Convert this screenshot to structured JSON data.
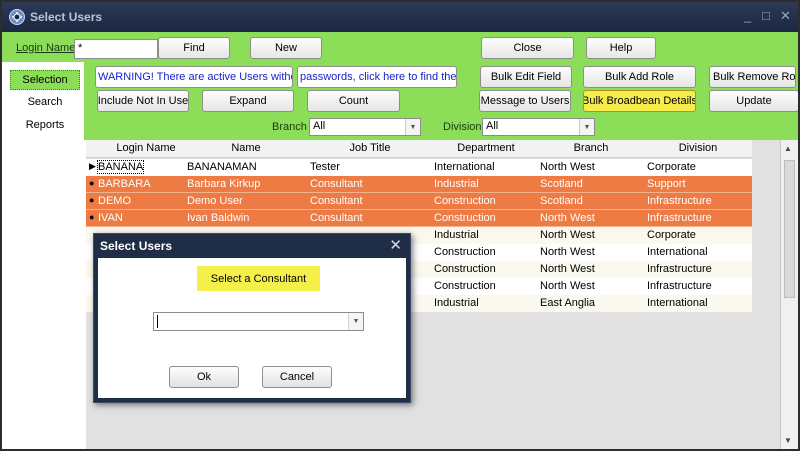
{
  "window": {
    "title": "Select Users",
    "controls": {
      "minimize": "_",
      "maximize": "□",
      "close": "✕"
    },
    "icon": "app-logo-icon"
  },
  "toolbar": {
    "login_label": "Login Name",
    "login_value": "*",
    "find": "Find",
    "new": "New",
    "close": "Close",
    "help": "Help",
    "warning_part1": "WARNING! There are active Users without",
    "warning_part2": "passwords, click here to find them.",
    "bulk_edit_field": "Bulk Edit Field",
    "bulk_add_role": "Bulk Add Role",
    "bulk_remove_role": "Bulk Remove Role",
    "include_not_in_use": "Include Not In Use",
    "expand": "Expand",
    "count": "Count",
    "message_to_users": "Message to Users",
    "bulk_broadbean_details": "Bulk Broadbean Details",
    "update": "Update",
    "branch_label": "Branch",
    "branch_value": "All",
    "division_label": "Division",
    "division_value": "All"
  },
  "sidebar": {
    "items": [
      {
        "label": "Selection"
      },
      {
        "label": "Search"
      },
      {
        "label": "Reports"
      }
    ]
  },
  "grid": {
    "columns": [
      "Login Name",
      "Name",
      "Job Title",
      "Department",
      "Branch",
      "Division"
    ],
    "rows": [
      {
        "indicator": "▶",
        "login": "BANANA",
        "name": "BANANAMAN",
        "job": "Tester",
        "dept": "International",
        "branch": "North West",
        "division": "Corporate"
      },
      {
        "indicator": "●",
        "login": "BARBARA",
        "name": "Barbara Kirkup",
        "job": "Consultant",
        "dept": "Industrial",
        "branch": "Scotland",
        "division": "Support"
      },
      {
        "indicator": "●",
        "login": "DEMO",
        "name": "Demo User",
        "job": "Consultant",
        "dept": "Construction",
        "branch": "Scotland",
        "division": "Infrastructure"
      },
      {
        "indicator": "●",
        "login": "IVAN",
        "name": "Ivan Baldwin",
        "job": "Consultant",
        "dept": "Construction",
        "branch": "North West",
        "division": "Infrastructure"
      },
      {
        "indicator": "",
        "login": "",
        "name": "",
        "job": "",
        "dept": "Industrial",
        "branch": "North West",
        "division": "Corporate"
      },
      {
        "indicator": "",
        "login": "",
        "name": "",
        "job": "",
        "dept": "Construction",
        "branch": "North West",
        "division": "International"
      },
      {
        "indicator": "",
        "login": "",
        "name": "",
        "job": "",
        "dept": "Construction",
        "branch": "North West",
        "division": "Infrastructure"
      },
      {
        "indicator": "",
        "login": "",
        "name": "",
        "job": "",
        "dept": "Construction",
        "branch": "North West",
        "division": "Infrastructure"
      },
      {
        "indicator": "",
        "login": "",
        "name": "",
        "job": "",
        "dept": "Industrial",
        "branch": "East Anglia",
        "division": "International"
      }
    ]
  },
  "dialog": {
    "title": "Select Users",
    "close": "✕",
    "prompt": "Select a Consultant",
    "select_value": "",
    "ok": "Ok",
    "cancel": "Cancel"
  },
  "colors": {
    "toolbar_green": "#8cdd58",
    "row_highlight": "#ee7b44",
    "highlight_yellow": "#f4ef4a",
    "warning_text": "#1a21c9",
    "dialog_title": "#1f2d46"
  }
}
